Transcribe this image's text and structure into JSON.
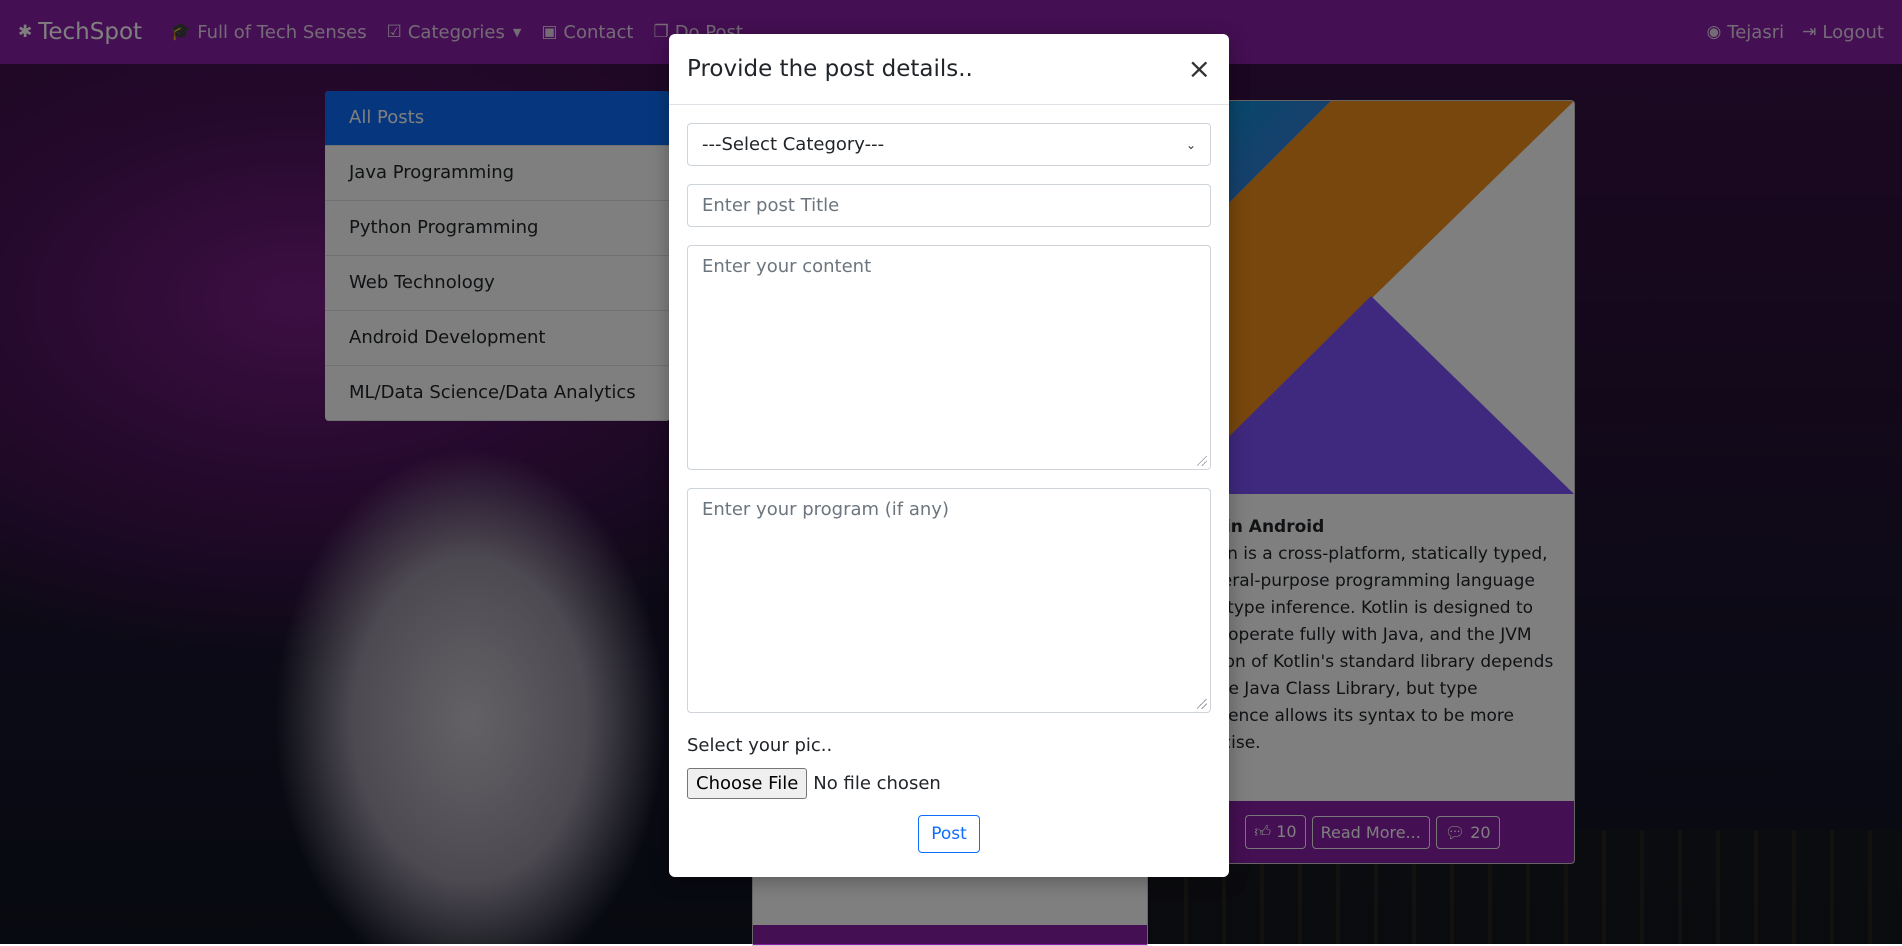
{
  "navbar": {
    "brand": "TechSpot",
    "items": [
      {
        "icon": "graduation-cap-icon",
        "label": "Full of Tech Senses"
      },
      {
        "icon": "check-square-icon",
        "label": "Categories"
      },
      {
        "icon": "address-book-icon",
        "label": "Contact"
      },
      {
        "icon": "copy-icon",
        "label": "Do Post"
      }
    ],
    "user": "Tejasri",
    "logout": "Logout",
    "color": "#8a1fa6"
  },
  "categories": [
    "All Posts",
    "Java Programming",
    "Python Programming",
    "Web Technology",
    "Android Development",
    "ML/Data Science/Data Analytics"
  ],
  "post_card": {
    "title": "tlin Android",
    "lines": [
      "tlin is a cross-platform, statically typed,",
      "neral-purpose programming language",
      "h type inference. Kotlin is designed to",
      "eroperate fully with Java, and the JVM",
      "sion of Kotlin's standard library depends",
      "the Java Class Library, but type",
      "erence allows its syntax to be more",
      "ncise."
    ],
    "likes": "10",
    "read_more": "Read More...",
    "comments": "20"
  },
  "modal": {
    "title": "Provide the post details..",
    "select_value": "---Select Category---",
    "title_placeholder": "Enter post Title",
    "content_placeholder": "Enter your content",
    "program_placeholder": "Enter your program (if any)",
    "pic_label": "Select your pic..",
    "file_button": "Choose File",
    "file_status": "No file chosen",
    "post_button": "Post"
  }
}
